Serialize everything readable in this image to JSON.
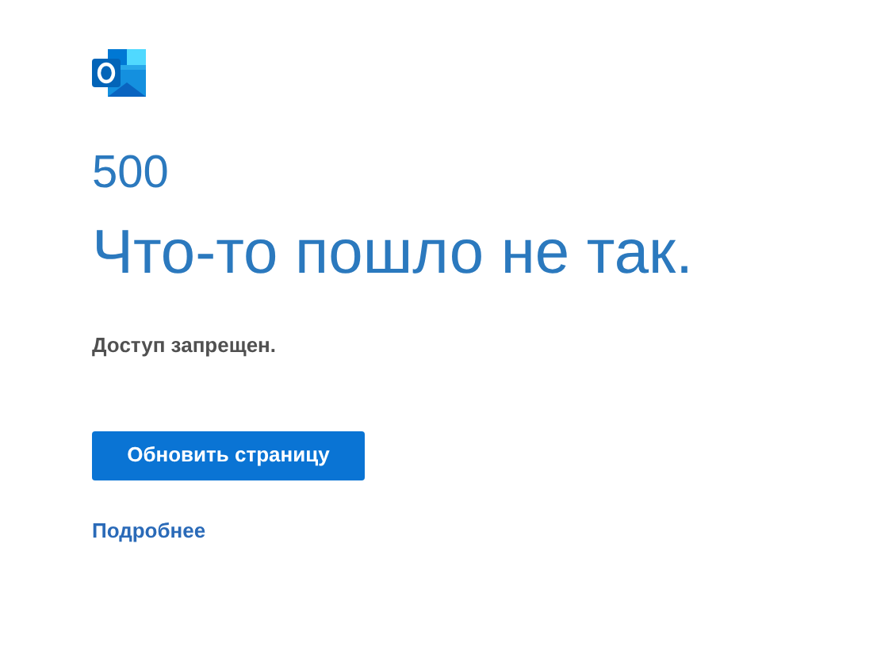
{
  "error_code": "500",
  "title": "Что-то пошло не так.",
  "message": "Доступ запрещен.",
  "button": "Обновить страницу",
  "link": "Подробнее"
}
